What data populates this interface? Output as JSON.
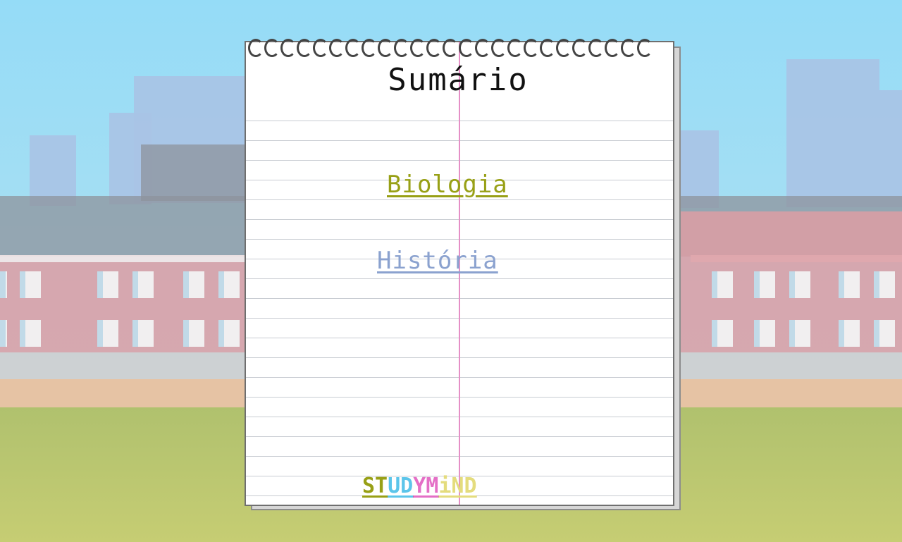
{
  "notebook": {
    "title": "Sumário"
  },
  "subjects": [
    {
      "label": "Biologia",
      "color": "#98a016"
    },
    {
      "label": "História",
      "color": "#8ba2cf"
    }
  ],
  "logo": {
    "parts": [
      {
        "text": "ST",
        "color": "#98a016"
      },
      {
        "text": "UD",
        "color": "#5cc5ea"
      },
      {
        "text": "YM",
        "color": "#e46fc6"
      },
      {
        "text": "iND",
        "color": "#e4dc7d"
      }
    ]
  },
  "colors": {
    "sky": "#95dcf7",
    "grass": "#b0c16e",
    "building_wall": "#dd9ea3",
    "notebook_margin": "#e58fc6"
  }
}
